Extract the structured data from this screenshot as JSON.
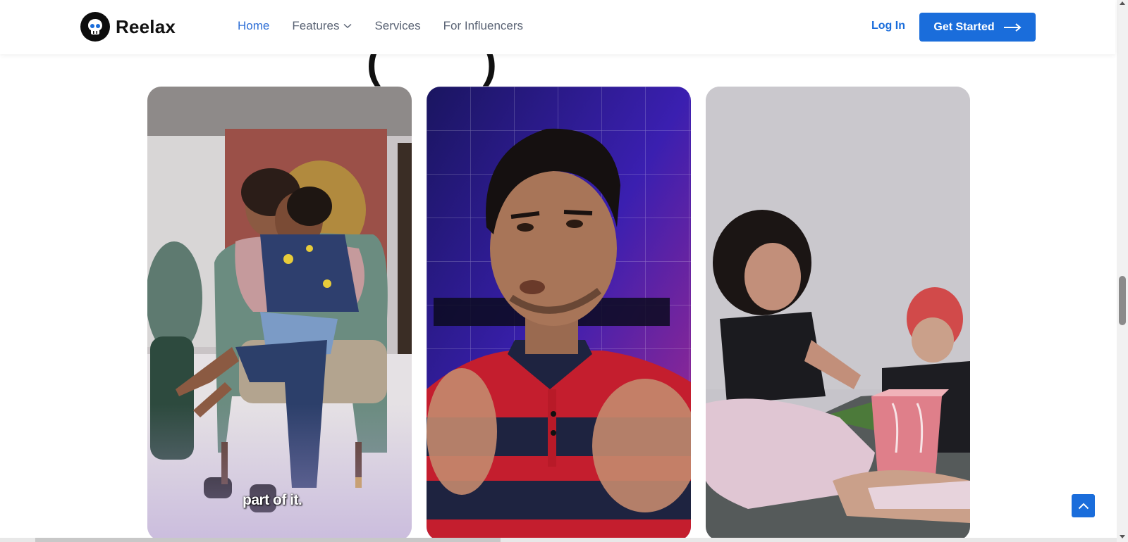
{
  "brand": {
    "name": "Reelax",
    "icon": "skull-logo-icon"
  },
  "nav": {
    "items": [
      {
        "label": "Home",
        "active": true
      },
      {
        "label": "Features",
        "has_dropdown": true
      },
      {
        "label": "Services"
      },
      {
        "label": "For Influencers"
      }
    ],
    "login_label": "Log In",
    "cta_label": "Get Started",
    "cta_icon": "arrow-right-icon"
  },
  "section": {
    "heading_peek": "( )"
  },
  "videos": [
    {
      "caption": "part of it.",
      "thumbnail": "mother-hugging-child-in-armchair"
    },
    {
      "caption": "",
      "thumbnail": "man-in-red-polo-speaking"
    },
    {
      "caption": "",
      "thumbnail": "woman-and-boy-opening-gift-bag"
    }
  ],
  "back_to_top_icon": "chevron-up-icon",
  "colors": {
    "accent": "#1a6ddb",
    "nav_active": "#2f6fd6",
    "nav_text": "#5b6475"
  }
}
